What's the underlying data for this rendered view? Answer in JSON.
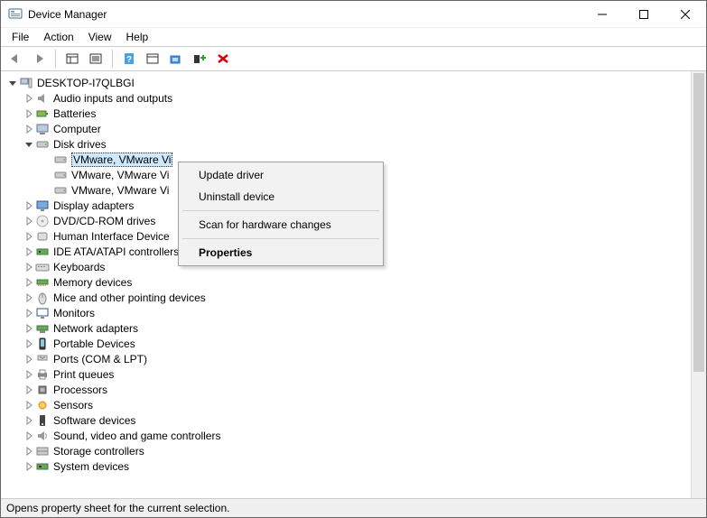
{
  "window": {
    "title": "Device Manager"
  },
  "menu": [
    "File",
    "Action",
    "View",
    "Help"
  ],
  "toolbar": {
    "back": "Back",
    "forward": "Forward",
    "props_console": "Console properties",
    "props_item": "Item properties",
    "help": "Help",
    "action_menu": "Action",
    "scan": "Scan for hardware changes",
    "add": "Add legacy hardware",
    "remove": "Uninstall device"
  },
  "root": {
    "label": "DESKTOP-I7QLBGI",
    "expanded": true
  },
  "categories": [
    {
      "label": "Audio inputs and outputs",
      "icon": "audio"
    },
    {
      "label": "Batteries",
      "icon": "battery"
    },
    {
      "label": "Computer",
      "icon": "computer"
    },
    {
      "label": "Disk drives",
      "icon": "disk",
      "expanded": true,
      "children": [
        {
          "label": "VMware, VMware Vi",
          "selected": true
        },
        {
          "label": "VMware, VMware Vi"
        },
        {
          "label": "VMware, VMware Vi"
        }
      ]
    },
    {
      "label": "Display adapters",
      "icon": "display"
    },
    {
      "label": "DVD/CD-ROM drives",
      "icon": "dvd"
    },
    {
      "label": "Human Interface Device",
      "icon": "hid"
    },
    {
      "label": "IDE ATA/ATAPI controllers",
      "icon": "ide"
    },
    {
      "label": "Keyboards",
      "icon": "keyboard"
    },
    {
      "label": "Memory devices",
      "icon": "memory"
    },
    {
      "label": "Mice and other pointing devices",
      "icon": "mouse"
    },
    {
      "label": "Monitors",
      "icon": "monitor"
    },
    {
      "label": "Network adapters",
      "icon": "network"
    },
    {
      "label": "Portable Devices",
      "icon": "portable"
    },
    {
      "label": "Ports (COM & LPT)",
      "icon": "ports"
    },
    {
      "label": "Print queues",
      "icon": "print"
    },
    {
      "label": "Processors",
      "icon": "cpu"
    },
    {
      "label": "Sensors",
      "icon": "sensor"
    },
    {
      "label": "Software devices",
      "icon": "software"
    },
    {
      "label": "Sound, video and game controllers",
      "icon": "sound"
    },
    {
      "label": "Storage controllers",
      "icon": "storage"
    },
    {
      "label": "System devices",
      "icon": "system"
    }
  ],
  "context_menu": {
    "update": "Update driver",
    "uninstall": "Uninstall device",
    "scan": "Scan for hardware changes",
    "properties": "Properties"
  },
  "status": "Opens property sheet for the current selection."
}
